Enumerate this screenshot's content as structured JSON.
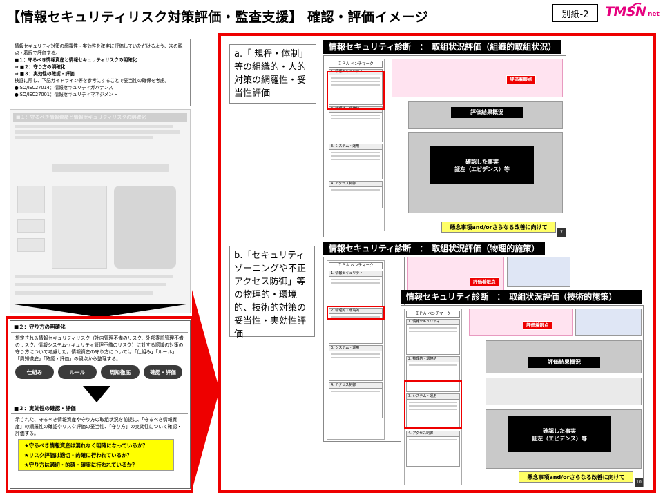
{
  "header": {
    "title": "【情報セキュリティリスク対策評価・監査支援】 確認・評価イメージ",
    "tag": "別紙-2",
    "logo_brand": "TMSN",
    "logo_suffix": "net"
  },
  "doc_top": {
    "intro": "情報セキュリティ対策の網羅性・実効性を確実に評価していただけるよう、次の観点・着眼で評価する。",
    "items": [
      "■１：守るべき情報資産と情報セキュリティリスクの明確化",
      "⇒ ■２：守り方の明確化",
      "⇒ ■３：実効性の確認・評価"
    ],
    "note": "検証に際し、下記ガイドライン等を参考にすることで妥当性の確保を考慮。",
    "refs": [
      "●ISO/IEC27014：情報セキュリティガバナンス",
      "●ISO/IEC27001：情報セキュリティマネジメント"
    ]
  },
  "faded": {
    "header": "■１：守るべき情報資産と情報セキュリティリスクの明確化"
  },
  "section2": {
    "title": "■２：守り方の明確化",
    "text": "想定される情報セキュリティリスク（社内管理不備のリスク、外部委託管理不備のリスク、情報システムセキュリティ管理不備のリスク）に対する認識の対策の守り方について考慮した。情報資産の守り方については「仕組み」「ルール」「周知徹底」「確認・評価」の観点から整理する。",
    "pills": [
      "仕組み",
      "ルール",
      "周知徹底",
      "確認・評価"
    ]
  },
  "section3": {
    "title": "■３：実効性の確認・評価",
    "text": "示された、守るべき情報資産や守り方の取組状況を前提に、「守るべき情報資産」の網羅性の確認やリスク評価の妥当性、「守り方」の実効性について確認・評価する。",
    "questions": [
      "★守るべき情報資産は漏れなく明確になっているか？",
      "★リスク評価は適切・的確に行われているか？",
      "★守り方は適切・的確・確実に行われているか？"
    ]
  },
  "callouts": {
    "a": "a.「 規程・体制」 等の組織的・人的対策の網羅性・妥当性評価",
    "b": "b.「セキュリティゾーニングや不正アクセス防御」等の物理的・環境的、技術的対策の妥当性・実効性評価"
  },
  "slides": {
    "s1": {
      "header": "情報セキュリティ診断　：　取組状況評価（組織的取組状況）",
      "benchmark": "ＩＰＡ ベンチマーク",
      "eval_point": "評価着眼点",
      "result": "評価結果概況",
      "fact_line1": "確認した事実",
      "fact_line2": "証左（エビデンス）等",
      "concern": "懸念事項and/orさらなる改善に向けて",
      "page": "7"
    },
    "s2": {
      "header": "情報セキュリティ診断　：　取組状況評価（物理的施策）",
      "benchmark": "ＩＰＡ ベンチマーク",
      "eval_point": "評価着眼点"
    },
    "s3": {
      "header": "情報セキュリティ診断　：　取組状況評価（技術的施策）",
      "benchmark": "ＩＰＡ ベンチマーク",
      "eval_point": "評価着眼点",
      "result": "評価結果概況",
      "fact_line1": "確認した事実",
      "fact_line2": "証左（エビデンス）等",
      "concern": "懸念事項and/orさらなる改善に向けて",
      "page": "10"
    }
  },
  "colors": {
    "accent_red": "#e00000",
    "brand_pink": "#e6007e",
    "highlight_yellow": "#ffff00"
  }
}
